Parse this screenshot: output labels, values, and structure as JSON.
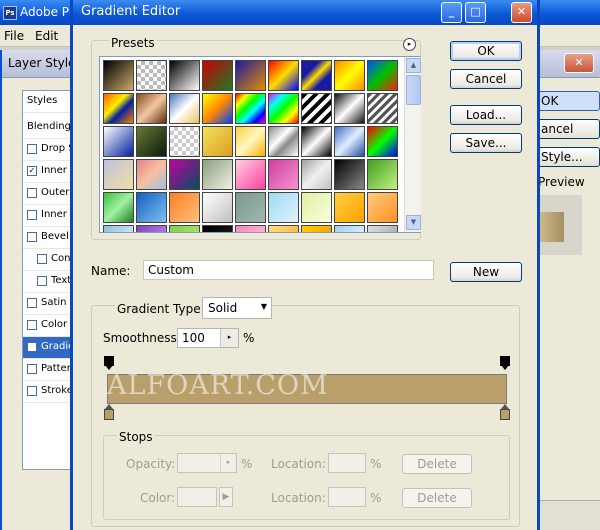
{
  "photoshop": {
    "title": "Adobe Ph",
    "icon": "Ps",
    "menu": [
      "File",
      "Edit"
    ]
  },
  "layer_style": {
    "title": "Layer Style",
    "close": "✕",
    "items": [
      {
        "label": "Styles",
        "checkbox": false,
        "checked": false,
        "indent": 0,
        "selected": false
      },
      {
        "label": "Blending O",
        "checkbox": false,
        "checked": false,
        "indent": 0,
        "selected": false
      },
      {
        "label": "Drop S",
        "checkbox": true,
        "checked": false,
        "indent": 0,
        "selected": false
      },
      {
        "label": "Inner S",
        "checkbox": true,
        "checked": true,
        "indent": 0,
        "selected": false
      },
      {
        "label": "Outer G",
        "checkbox": true,
        "checked": false,
        "indent": 0,
        "selected": false
      },
      {
        "label": "Inner G",
        "checkbox": true,
        "checked": false,
        "indent": 0,
        "selected": false
      },
      {
        "label": "Bevel a",
        "checkbox": true,
        "checked": false,
        "indent": 0,
        "selected": false
      },
      {
        "label": "Con",
        "checkbox": true,
        "checked": false,
        "indent": 1,
        "selected": false
      },
      {
        "label": "Text",
        "checkbox": true,
        "checked": false,
        "indent": 1,
        "selected": false
      },
      {
        "label": "Satin",
        "checkbox": true,
        "checked": false,
        "indent": 0,
        "selected": false
      },
      {
        "label": "Color O",
        "checkbox": true,
        "checked": false,
        "indent": 0,
        "selected": false
      },
      {
        "label": "Gradie",
        "checkbox": true,
        "checked": true,
        "indent": 0,
        "selected": true
      },
      {
        "label": "Pattern",
        "checkbox": true,
        "checked": false,
        "indent": 0,
        "selected": false
      },
      {
        "label": "Stroke",
        "checkbox": true,
        "checked": false,
        "indent": 0,
        "selected": false
      }
    ],
    "buttons": [
      "OK",
      "ancel",
      "Style..."
    ],
    "preview_label": "Preview"
  },
  "gradient_editor": {
    "title": "Gradient Editor",
    "title_buttons": [
      "_",
      "□",
      "✕"
    ],
    "presets_label": "Presets",
    "presets_menu_icon": "▸",
    "swatches": [
      "linear-gradient(135deg,#000,#c9a96a)",
      "repeating-conic-gradient(#bbb 0 25%,#fff 0 50%) 0 0/8px 8px",
      "linear-gradient(135deg,#000,#fff)",
      "linear-gradient(135deg,#c00,#1a7a2a)",
      "linear-gradient(135deg,#1a1aa0,#e88b00)",
      "linear-gradient(135deg,#ff0000,#ffdd00 50%,#0000ff)",
      "linear-gradient(135deg,#1a1aa0 30%,#ffdd00 50%,#1a1aa0 70%)",
      "linear-gradient(135deg,#ff8800,#ffff00 50%,#ff8800)",
      "linear-gradient(135deg,#0050ff,#00c000 50%,#ff2000)",
      "linear-gradient(135deg,#ff6000,#ffee00 40%,#0020a0 60%,#ff8000)",
      "linear-gradient(135deg,#8a4a20,#f2c8a0 50%,#5a2a10)",
      "linear-gradient(135deg,#5070c0,#ffffff 50%,#e8c060)",
      "linear-gradient(135deg,#ffff00,#ff8800 50%,#0040ff)",
      "linear-gradient(135deg,#ff0000,#ffff00,#00ff00,#00ffff,#0000ff,#ff00ff)",
      "linear-gradient(135deg,#ff00ff,#00ffff,#00ff00,#ffff00,#ff0000)",
      "repeating-linear-gradient(135deg,#000 0 4px,#fff 4px 8px)",
      "linear-gradient(135deg,#111,#fff 50%,#111)",
      "repeating-linear-gradient(135deg,#555 0 3px,#fff 3px 6px)",
      "linear-gradient(135deg,#fff,#0020a0)",
      "linear-gradient(135deg,#6a7a30,#0a1a10)",
      "repeating-conic-gradient(#ccc 0 25%,#fff 0 50%) 0 0/8px 8px",
      "linear-gradient(135deg,#f4e060,#d8a020)",
      "linear-gradient(135deg,#ffd040,#fff6c0 50%,#ffb000)",
      "linear-gradient(135deg,#888,#fff 40%,#888 60%,#fff)",
      "linear-gradient(135deg,#000,#fff 50%,#000)",
      "linear-gradient(135deg,#4070c0,#e0eeff 50%,#2050a0)",
      "linear-gradient(135deg,#ff0000,#00ff00 50%,#0000ff)",
      "linear-gradient(135deg,#c0c0e0,#f0e0a0)",
      "linear-gradient(135deg,#e08090,#f8c0a0 50%,#a0c0e0)",
      "linear-gradient(135deg,#c000a0,#005060)",
      "linear-gradient(135deg,#8aa080,#f0f0e0)",
      "linear-gradient(135deg,#ffd0e0,#ff40a0)",
      "linear-gradient(135deg,#cc40a0,#f890d0)",
      "linear-gradient(135deg,#a0a0a0,#f0f0f0 50%,#c0c0c0)",
      "linear-gradient(135deg,#000,#888)",
      "linear-gradient(135deg,#40a020,#c0f080)",
      "linear-gradient(135deg,#40c040,#a0f0a0 50%,#208020)",
      "linear-gradient(135deg,#1060c0,#80c0f0)",
      "linear-gradient(135deg,#ff8020,#ffc080)",
      "linear-gradient(135deg,#ffffff,#c0c0c0)",
      "linear-gradient(135deg,#7a9a90,#a0b8b0)",
      "linear-gradient(135deg,#a0d8f0,#e0f4ff)",
      "linear-gradient(135deg,#e0f0a0,#f8ffe0)",
      "linear-gradient(135deg,#ffd040,#ffa000)",
      "linear-gradient(135deg,#ffcc80,#ff9020)",
      "linear-gradient(135deg,#90c0e0,#f0f8ff)",
      "linear-gradient(135deg,#8040c0,#d0a0f0)",
      "linear-gradient(135deg,#80d040,#c0f080)",
      "linear-gradient(135deg,#000,#222)",
      "linear-gradient(135deg,#ff80c0,#ffd0e8)",
      "linear-gradient(135deg,#ffe080,#ffa020)",
      "linear-gradient(135deg,#ffd000,#ff8000)",
      "linear-gradient(135deg,#a0d0f0,#ffffff)",
      "linear-gradient(135deg,#e0e0e0,#909090)",
      "linear-gradient(135deg,#80c0ff,#ffffff)",
      "linear-gradient(135deg,#ffb000,#ffe080)"
    ],
    "buttons": {
      "ok": "OK",
      "cancel": "Cancel",
      "load": "Load...",
      "save": "Save...",
      "new": "New"
    },
    "name_label": "Name:",
    "name_value": "Custom",
    "gradient_type_label": "Gradient Type:",
    "gradient_type_value": "Solid",
    "smoothness_label": "Smoothness:",
    "smoothness_value": "100",
    "smoothness_unit": "%",
    "gradient": {
      "left_color": "#b9a06b",
      "right_color": "#b9a06b",
      "opacity_stop_color": "#000000"
    },
    "watermark": "ALFOART.COM",
    "stops": {
      "label": "Stops",
      "opacity_label": "Opacity:",
      "opacity_unit": "%",
      "color_label": "Color:",
      "location_label": "Location:",
      "location_unit": "%",
      "delete_label": "Delete"
    }
  }
}
